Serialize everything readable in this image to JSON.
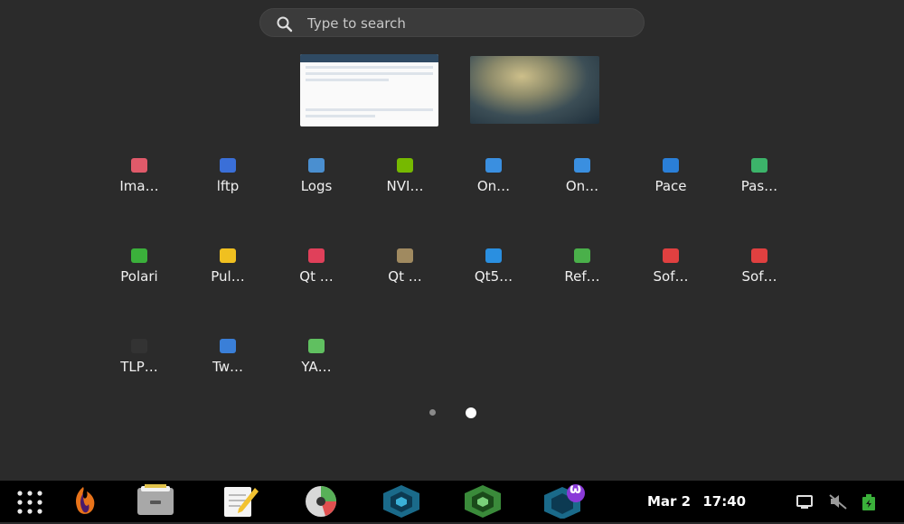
{
  "search": {
    "placeholder": "Type to search",
    "value": ""
  },
  "windows": [
    {
      "name": "window-thumbnail-app"
    },
    {
      "name": "window-thumbnail-image"
    }
  ],
  "apps": [
    {
      "label": "Ima…",
      "icon": "image-viewer-icon",
      "color": "#e05a6a"
    },
    {
      "label": "lftp",
      "icon": "ftp-icon",
      "color": "#3a6fd8"
    },
    {
      "label": "Logs",
      "icon": "logs-icon",
      "color": "#4a8fd0"
    },
    {
      "label": "NVI…",
      "icon": "nvidia-icon",
      "color": "#76b900"
    },
    {
      "label": "On…",
      "icon": "onboard-icon",
      "color": "#3a8fe0"
    },
    {
      "label": "On…",
      "icon": "onboard-settings-icon",
      "color": "#3a8fe0"
    },
    {
      "label": "Pace",
      "icon": "pace-icon",
      "color": "#2a7fd8"
    },
    {
      "label": "Pas…",
      "icon": "password-icon",
      "color": "#3cb46a"
    },
    {
      "label": "Polari",
      "icon": "polari-icon",
      "color": "#3bb03b"
    },
    {
      "label": "Pul…",
      "icon": "pulseaudio-icon",
      "color": "#f0c020"
    },
    {
      "label": "Qt …",
      "icon": "qt-designer-icon",
      "color": "#e0405a"
    },
    {
      "label": "Qt …",
      "icon": "qt-linguist-icon",
      "color": "#a08a60"
    },
    {
      "label": "Qt5…",
      "icon": "qt5-icon",
      "color": "#2a8fe0"
    },
    {
      "label": "Ref…",
      "icon": "refresh-cloud-icon",
      "color": "#4ab04a"
    },
    {
      "label": "Sof…",
      "icon": "software-icon",
      "color": "#e04040"
    },
    {
      "label": "Sof…",
      "icon": "software-properties-icon",
      "color": "#e04040"
    },
    {
      "label": "TLP…",
      "icon": "tlp-icon",
      "color": "#333333"
    },
    {
      "label": "Tw…",
      "icon": "tweaks-icon",
      "color": "#3a7fd8"
    },
    {
      "label": "YA…",
      "icon": "yad-icon",
      "color": "#60c060"
    }
  ],
  "pagination": {
    "pages": 2,
    "current": 2
  },
  "dock": {
    "items": [
      "app-grid-icon",
      "firefox-icon",
      "files-icon",
      "text-editor-icon",
      "disk-usage-icon",
      "hexagon-app-icon",
      "hexagon-green-app-icon",
      "hexagon-badge-app-icon"
    ],
    "badge": "ω"
  },
  "clock": {
    "date": "Mar 2",
    "time": "17:40"
  },
  "tray": [
    "screen-icon",
    "mute-icon",
    "battery-icon"
  ]
}
